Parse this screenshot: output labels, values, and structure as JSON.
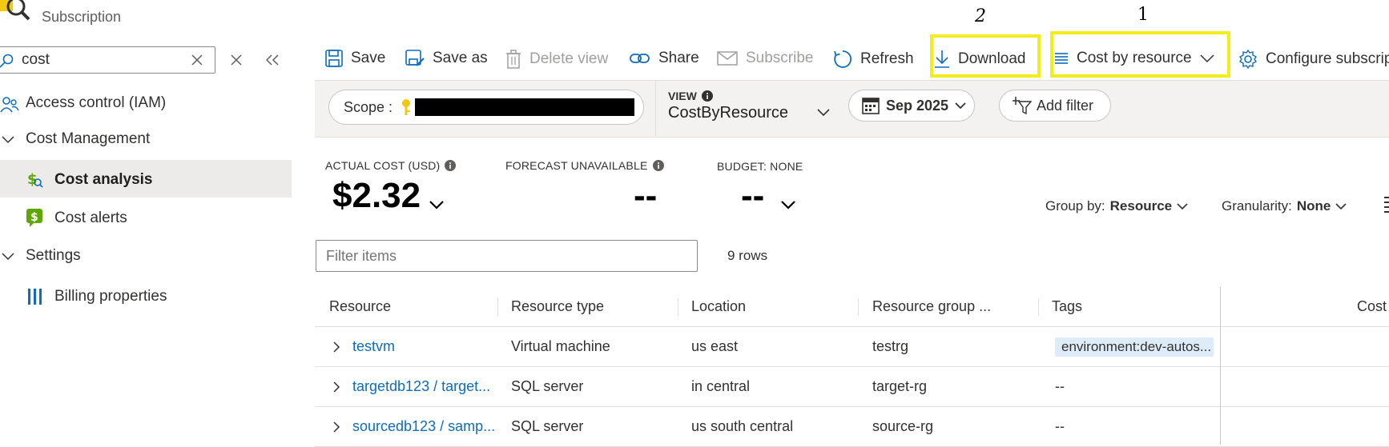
{
  "header": {
    "subtitle": "Subscription"
  },
  "sidebar": {
    "search_value": "cost",
    "items": [
      {
        "label": "Access control (IAM)"
      },
      {
        "label": "Cost Management"
      },
      {
        "label": "Cost analysis"
      },
      {
        "label": "Cost alerts"
      },
      {
        "label": "Settings"
      },
      {
        "label": "Billing properties"
      }
    ]
  },
  "toolbar": {
    "save": "Save",
    "save_as": "Save as",
    "delete_view": "Delete view",
    "share": "Share",
    "subscribe": "Subscribe",
    "refresh": "Refresh",
    "download": "Download",
    "cost_by_resource": "Cost by resource",
    "configure": "Configure subscription"
  },
  "annotations": {
    "mark_download": "2",
    "mark_cost_by_resource": "1"
  },
  "filters": {
    "scope_label": "Scope :",
    "view_label": "VIEW",
    "view_value": "CostByResource",
    "date": "Sep 2025",
    "add_filter": "Add filter"
  },
  "summary": {
    "actual_label": "ACTUAL COST (USD)",
    "actual_value": "$2.32",
    "forecast_label": "FORECAST UNAVAILABLE",
    "forecast_value": "--",
    "budget_label": "BUDGET: NONE",
    "budget_value": "--"
  },
  "controls": {
    "group_by_label": "Group by:",
    "group_by_value": "Resource",
    "granularity_label": "Granularity:",
    "granularity_value": "None"
  },
  "table": {
    "filter_placeholder": "Filter items",
    "row_count": "9 rows",
    "headers": [
      "Resource",
      "Resource type",
      "Location",
      "Resource group ...",
      "Tags",
      "Cost"
    ],
    "rows": [
      {
        "resource": "testvm",
        "type": "Virtual machine",
        "location": "us east",
        "group": "testrg",
        "tags": "environment:dev-autos..."
      },
      {
        "resource": "targetdb123 / target...",
        "type": "SQL server",
        "location": "in central",
        "group": "target-rg",
        "tags": "--"
      },
      {
        "resource": "sourcedb123 / samp...",
        "type": "SQL server",
        "location": "us south central",
        "group": "source-rg",
        "tags": "--"
      }
    ]
  },
  "colors": {
    "highlight": "#f2ee1c",
    "link": "#0f6cbd",
    "selected_bg": "#edebe9"
  }
}
